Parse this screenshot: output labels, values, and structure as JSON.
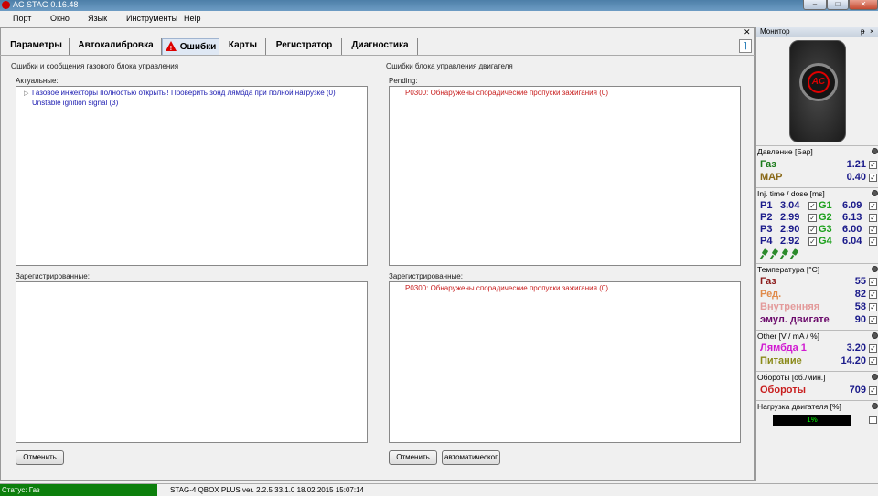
{
  "window": {
    "title": "AC STAG 0.16.48",
    "min": "–",
    "max": "□",
    "close": "✕"
  },
  "menu": [
    "Порт",
    "Окно",
    "Язык",
    "Инструменты",
    "Help"
  ],
  "tabs": [
    "Параметры",
    "Автокалибровка",
    "Ошибки",
    "Карты",
    "Регистратор",
    "Диагностика"
  ],
  "active_tab": "Ошибки",
  "left": {
    "group_title": "Ошибки и сообщения газового блока управления",
    "actual_label": "Актуальные:",
    "actual_entries": [
      "Газовое инжекторы полностью открыты! Проверить зонд лямбда при полной нагрузке (0)",
      "Unstable ignition signal (3)"
    ],
    "registered_label": "Зарегистрированные:",
    "cancel_label": "Отменить"
  },
  "right": {
    "group_title": "Ошибки блока управления двигателя",
    "pending_label": "Pending:",
    "pending_entries": [
      "P0300: Обнаружены спорадические пропуски зажигания (0)"
    ],
    "registered_label": "Зарегистрированные:",
    "registered_entries": [
      "P0300: Обнаружены спорадические пропуски зажигания (0)"
    ],
    "cancel_label": "Отменить",
    "auto_label": "автоматическог"
  },
  "status": {
    "left": "Статус: Газ",
    "right": "STAG-4 QBOX PLUS  ver. 2.2.5  33.1.0   18.02.2015 15:07:14",
    "green": "#0c7f0c"
  },
  "monitor": {
    "title": "Монитор",
    "pin": "ᵽ",
    "close": "×",
    "device_logo": "AC",
    "pressure": {
      "title": "Давление [Бар]",
      "gas_label": "Газ",
      "gas_value": "1.21",
      "map_label": "MAP",
      "map_value": "0.40"
    },
    "inj": {
      "title": "Inj. time / dose [ms]",
      "p": [
        {
          "label": "P1",
          "value": "3.04"
        },
        {
          "label": "P2",
          "value": "2.99"
        },
        {
          "label": "P3",
          "value": "2.90"
        },
        {
          "label": "P4",
          "value": "2.92"
        }
      ],
      "g": [
        {
          "label": "G1",
          "value": "6.09"
        },
        {
          "label": "G2",
          "value": "6.13"
        },
        {
          "label": "G3",
          "value": "6.00"
        },
        {
          "label": "G4",
          "value": "6.04"
        }
      ]
    },
    "temp": {
      "title": "Температура [°C]",
      "rows": [
        {
          "label": "Газ",
          "value": "55",
          "color": "#8b1a1a"
        },
        {
          "label": "Ред.",
          "value": "82",
          "color": "#e08a4a"
        },
        {
          "label": "Внутренняя",
          "value": "58",
          "color": "#e39a9a"
        },
        {
          "label": "эмул. двигате",
          "value": "90",
          "color": "#6b0a6b"
        }
      ]
    },
    "other": {
      "title": "Other [V / mA / %]",
      "rows": [
        {
          "label": "Лямбда 1",
          "value": "3.20",
          "color": "#d11ad1"
        },
        {
          "label": "Питание",
          "value": "14.20",
          "color": "#8a8a1a"
        }
      ]
    },
    "rpm": {
      "title": "Обороты [об./мин.]",
      "label": "Обороты",
      "value": "709"
    },
    "load": {
      "title": "Нагрузка двигателя [%]",
      "value": "1%"
    },
    "check": "✓"
  }
}
